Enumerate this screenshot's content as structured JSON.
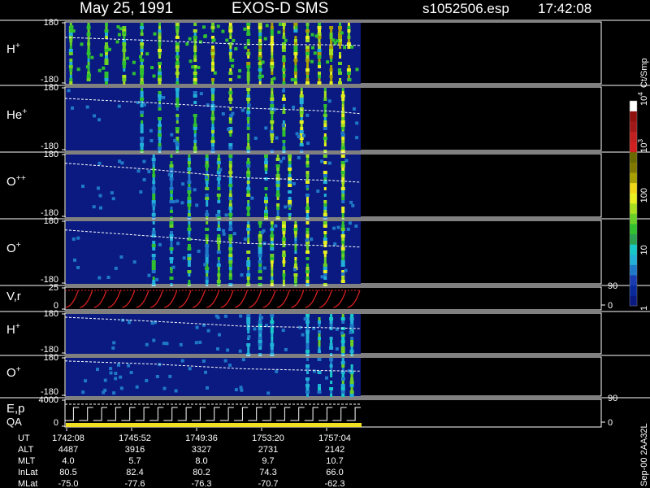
{
  "header": {
    "date": "May 25, 1991",
    "instrument": "EXOS-D SMS",
    "file": "s1052506.esp",
    "time": "17:42:08"
  },
  "colorbar": {
    "unit": "Ct/Smp",
    "ticks": [
      {
        "label": "1",
        "sup": "",
        "frac": 0.0
      },
      {
        "label": "10",
        "sup": "",
        "frac": 0.272
      },
      {
        "label": "100",
        "sup": "",
        "frac": 0.526
      },
      {
        "label": "10",
        "sup": "3",
        "frac": 0.771
      },
      {
        "label": "10",
        "sup": "4",
        "frac": 1.0
      }
    ],
    "colors": [
      "#0a1a80",
      "#0a2a9c",
      "#1a3cb0",
      "#1f78c8",
      "#22b0d8",
      "#18c8c8",
      "#2aa050",
      "#30c030",
      "#6ad028",
      "#a8e020",
      "#e8f020",
      "#f0d818",
      "#a8a000",
      "#807800",
      "#6a6a00",
      "#d02020",
      "#c02020",
      "#a01818",
      "#901010",
      "#ffffff"
    ]
  },
  "chart_data": [
    {
      "type": "heatmap",
      "panel": "H+ (1)",
      "label": "H",
      "label_sup": "+",
      "yticks": [
        "180",
        "-180"
      ],
      "ylim": [
        -180,
        180
      ],
      "intensity": "high",
      "columns": [
        0.02,
        0.08,
        0.14,
        0.2,
        0.26,
        0.32,
        0.38,
        0.44,
        0.5,
        0.56,
        0.62,
        0.66,
        0.7,
        0.74,
        0.78,
        0.82,
        0.86,
        0.9,
        0.93,
        0.96
      ],
      "trend": [
        [
          0.0,
          0.25
        ],
        [
          0.3,
          0.3
        ],
        [
          0.6,
          0.36
        ],
        [
          0.9,
          0.37
        ],
        [
          1.0,
          0.38
        ]
      ]
    },
    {
      "type": "heatmap",
      "panel": "He+",
      "label": "He",
      "label_sup": "+",
      "yticks": [
        "180",
        "-180"
      ],
      "ylim": [
        -180,
        180
      ],
      "intensity": "medium",
      "columns": [
        0.26,
        0.32,
        0.38,
        0.44,
        0.5,
        0.56,
        0.62,
        0.7,
        0.74,
        0.8,
        0.88,
        0.94
      ],
      "trend": [
        [
          0.0,
          0.18
        ],
        [
          0.3,
          0.25
        ],
        [
          0.6,
          0.33
        ],
        [
          0.9,
          0.38
        ],
        [
          1.0,
          0.42
        ]
      ]
    },
    {
      "type": "heatmap",
      "panel": "O++",
      "label": "O",
      "label_sup": "++",
      "yticks": [
        "180",
        "-180"
      ],
      "ylim": [
        -180,
        180
      ],
      "intensity": "medium",
      "columns": [
        0.3,
        0.36,
        0.42,
        0.48,
        0.52,
        0.56,
        0.62,
        0.68,
        0.72,
        0.76,
        0.82,
        0.88,
        0.94
      ],
      "trend": [
        [
          0.0,
          0.15
        ],
        [
          0.3,
          0.25
        ],
        [
          0.6,
          0.38
        ],
        [
          0.9,
          0.42
        ],
        [
          1.0,
          0.45
        ]
      ]
    },
    {
      "type": "heatmap",
      "panel": "O+ (1)",
      "label": "O",
      "label_sup": "+",
      "yticks": [
        "180",
        "-180"
      ],
      "ylim": [
        -180,
        180
      ],
      "intensity": "medium",
      "columns": [
        0.3,
        0.36,
        0.42,
        0.48,
        0.52,
        0.56,
        0.62,
        0.66,
        0.7,
        0.74,
        0.78,
        0.82,
        0.88,
        0.94
      ],
      "trend": [
        [
          0.0,
          0.15
        ],
        [
          0.3,
          0.25
        ],
        [
          0.6,
          0.36
        ],
        [
          0.9,
          0.4
        ],
        [
          1.0,
          0.42
        ]
      ]
    },
    {
      "type": "line",
      "panel": "V,r",
      "label": "V,r",
      "label_sup": "",
      "yticks": [
        "25",
        "0"
      ],
      "ylim": [
        0,
        25
      ],
      "right_ticks": [
        "90",
        "0"
      ],
      "cycles": 21
    },
    {
      "type": "heatmap",
      "panel": "H+ (2)",
      "label": "H",
      "label_sup": "+",
      "yticks": [
        "180",
        "-180"
      ],
      "ylim": [
        -180,
        180
      ],
      "intensity": "low",
      "columns": [
        0.62,
        0.66,
        0.7,
        0.82,
        0.86,
        0.9,
        0.94,
        0.97
      ],
      "trend": [
        [
          0.0,
          0.1
        ],
        [
          0.3,
          0.2
        ],
        [
          0.6,
          0.32
        ],
        [
          0.9,
          0.36
        ],
        [
          1.0,
          0.38
        ]
      ]
    },
    {
      "type": "heatmap",
      "panel": "O+ (2)",
      "label": "O",
      "label_sup": "+",
      "yticks": [
        "180",
        "-180"
      ],
      "ylim": [
        -180,
        180
      ],
      "intensity": "low",
      "columns": [
        0.82,
        0.86,
        0.9,
        0.94,
        0.97
      ],
      "trend": [
        [
          0.0,
          0.1
        ],
        [
          0.3,
          0.18
        ],
        [
          0.6,
          0.3
        ],
        [
          0.9,
          0.35
        ],
        [
          1.0,
          0.36
        ]
      ]
    },
    {
      "type": "line",
      "panel": "E,p QA",
      "label": "E,p",
      "label_sup": "",
      "label2": "QA",
      "yticks": [
        "4000",
        "0"
      ],
      "ylim": [
        0,
        4000
      ],
      "right_ticks": [
        "90",
        "0"
      ],
      "cycles": 21
    }
  ],
  "footer": {
    "rows": [
      {
        "label": "UT",
        "values": [
          "1742:08",
          "1745:52",
          "1749:36",
          "1753:20",
          "1757:04"
        ]
      },
      {
        "label": "ALT",
        "values": [
          "4487",
          "3916",
          "3327",
          "2731",
          "2142"
        ]
      },
      {
        "label": "MLT",
        "values": [
          "4.0",
          "5.7",
          "8.0",
          "9.7",
          "10.7"
        ]
      },
      {
        "label": "InLat",
        "values": [
          "80.5",
          "82.4",
          "80.2",
          "74.3",
          "66.0"
        ]
      },
      {
        "label": "MLat",
        "values": [
          "-75.0",
          "-77.6",
          "-76.3",
          "-70.7",
          "-62.3"
        ]
      }
    ],
    "stamp": "Sep-00  2AA32L"
  }
}
